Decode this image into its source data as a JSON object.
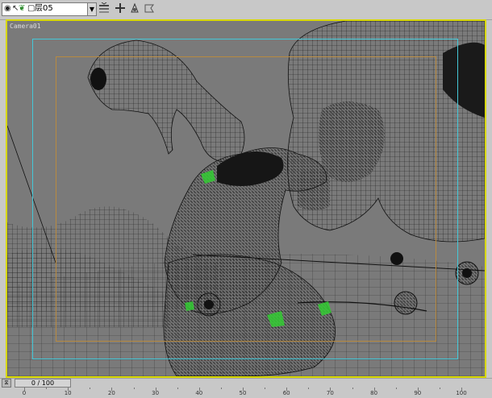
{
  "toolbar": {
    "layer_name": "层05",
    "icons": [
      "eye-icon",
      "cursor-icon",
      "leaf-icon",
      "box-icon",
      "layer-manager-icon",
      "add-object-icon",
      "select-layer-icon",
      "highlight-icon"
    ]
  },
  "viewport": {
    "label": "Camera01"
  },
  "time_slider": {
    "label": "0 / 100",
    "current_frame": 0,
    "total_frames": 100
  },
  "ruler": {
    "ticks": [
      "0",
      "10",
      "20",
      "30",
      "40",
      "50",
      "60",
      "70",
      "80",
      "90",
      "100"
    ]
  },
  "colors": {
    "frame_yellow": "#d8d800",
    "safe_cyan": "#44c8d8",
    "safe_orange": "#b88a40",
    "wire": "#111111",
    "selection_green": "#33cc33"
  }
}
